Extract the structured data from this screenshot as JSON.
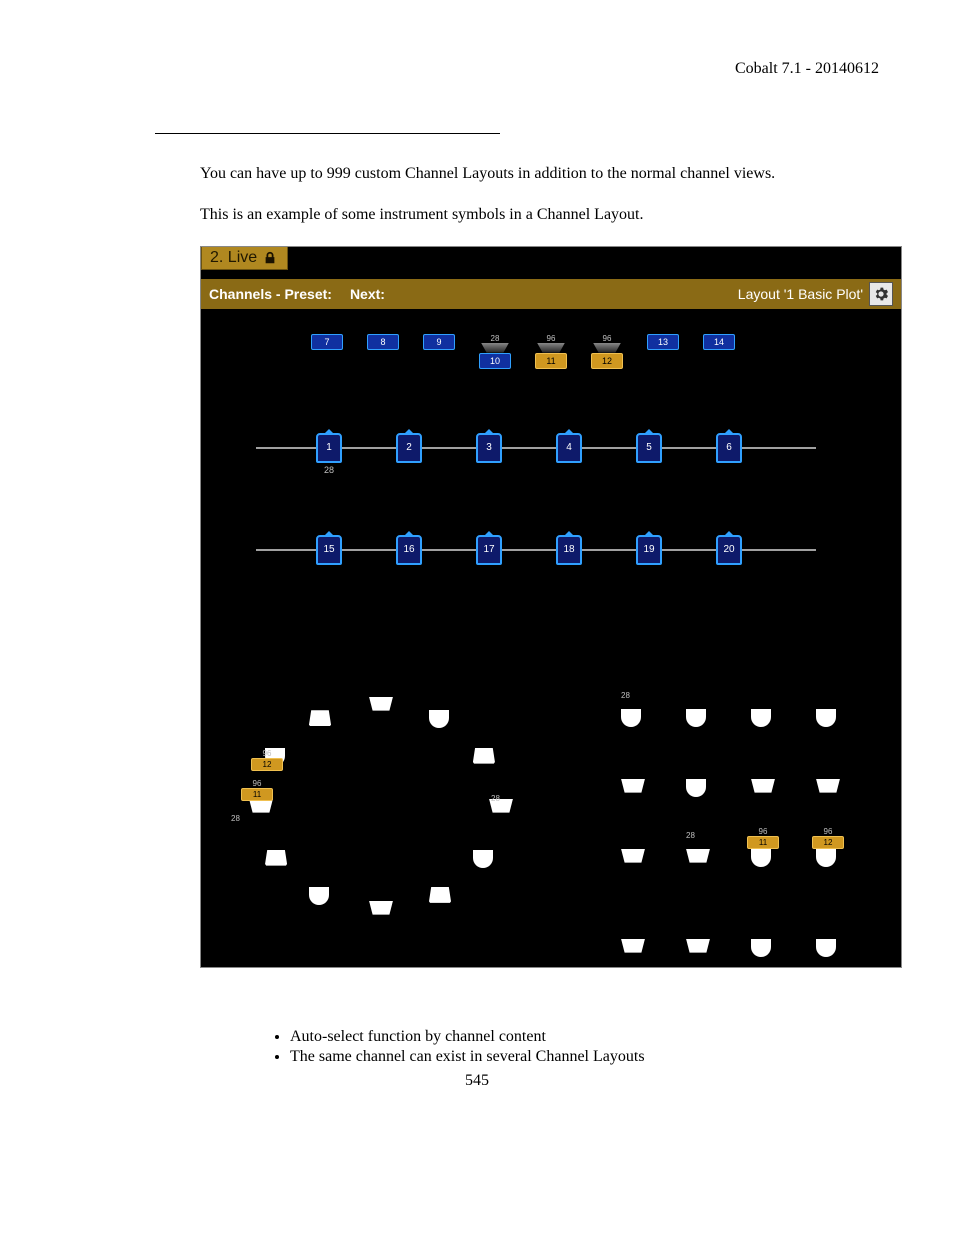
{
  "header": "Cobalt 7.1 - 20140612",
  "p1": "You can have up to 999 custom Channel Layouts in addition to the normal channel views.",
  "p2": "This is an example of some instrument symbols in a Channel Layout.",
  "app": {
    "tab_label": "2. Live",
    "toolbar_left_bold": "Channels - Preset:",
    "toolbar_left_next": "Next:",
    "toolbar_right": "Layout '1 Basic Plot'"
  },
  "row1": [
    {
      "ch": "7"
    },
    {
      "ch": "8"
    },
    {
      "ch": "9"
    },
    {
      "ch": "10",
      "v": "28"
    },
    {
      "ch": "11",
      "v": "96",
      "hl": true
    },
    {
      "ch": "12",
      "v": "96",
      "hl": true
    },
    {
      "ch": "13"
    },
    {
      "ch": "14"
    }
  ],
  "row2_below_val": "28",
  "row2": [
    "1",
    "2",
    "3",
    "4",
    "5",
    "6"
  ],
  "row3": [
    "15",
    "16",
    "17",
    "18",
    "19",
    "20"
  ],
  "circle_labels": {
    "a": "96",
    "ah": "12",
    "b": "96",
    "bh": "11",
    "c": "28",
    "d": "28"
  },
  "grid_labels": {
    "a": "28",
    "b": "28",
    "l1": "96",
    "h1": "11",
    "l2": "96",
    "h2": "12"
  },
  "bullet1": "Auto-select function by channel content",
  "bullet2": "The same channel can exist in several Channel Layouts",
  "page_number": "545"
}
